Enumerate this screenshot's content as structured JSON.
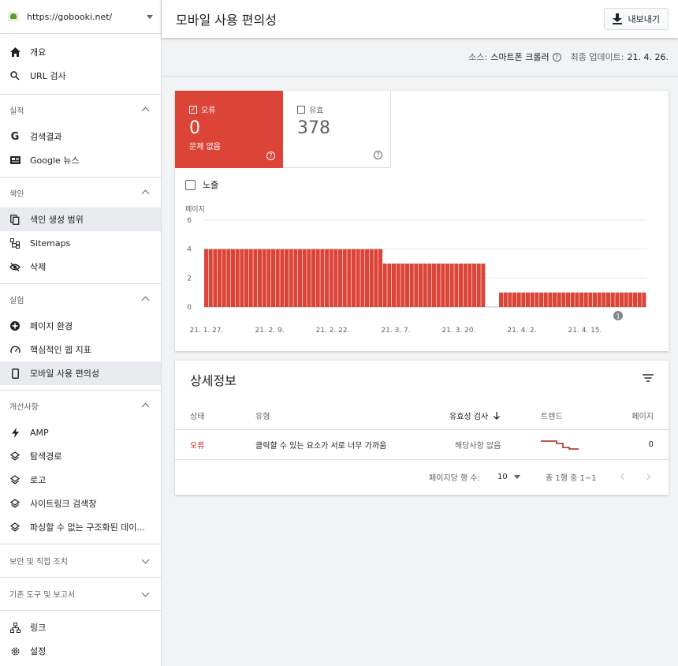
{
  "property": {
    "url": "https://gobooki.net/"
  },
  "sidebar": {
    "top_items": [
      {
        "label": "개요",
        "icon": "home-icon"
      },
      {
        "label": "URL 검사",
        "icon": "search-icon"
      }
    ],
    "sections": [
      {
        "title": "실적",
        "items": [
          {
            "label": "검색결과",
            "icon": "google-icon"
          },
          {
            "label": "Google 뉴스",
            "icon": "news-icon"
          }
        ]
      },
      {
        "title": "색인",
        "items": [
          {
            "label": "색인 생성 범위",
            "icon": "file-copy-icon"
          },
          {
            "label": "Sitemaps",
            "icon": "sitemap-icon"
          },
          {
            "label": "삭제",
            "icon": "eye-off-icon"
          }
        ]
      },
      {
        "title": "실험",
        "items": [
          {
            "label": "페이지 환경",
            "icon": "plus-circle-icon"
          },
          {
            "label": "핵심적인 웹 지표",
            "icon": "speed-icon"
          },
          {
            "label": "모바일 사용 편의성",
            "icon": "phone-icon"
          }
        ]
      },
      {
        "title": "개선사항",
        "items": [
          {
            "label": "AMP",
            "icon": "bolt-icon"
          },
          {
            "label": "탐색경로",
            "icon": "layers-icon"
          },
          {
            "label": "로고",
            "icon": "layers-icon"
          },
          {
            "label": "사이트링크 검색창",
            "icon": "layers-icon"
          },
          {
            "label": "파싱할 수 없는 구조화된 데이...",
            "icon": "layers-icon"
          }
        ]
      }
    ],
    "collapsed_sections": [
      {
        "title": "보안 및 직접 조치"
      },
      {
        "title": "기존 도구 및 보고서"
      }
    ],
    "bottom_items": [
      {
        "label": "링크",
        "icon": "links-icon"
      },
      {
        "label": "설정",
        "icon": "gear-icon"
      }
    ]
  },
  "header": {
    "title": "모바일 사용 편의성",
    "export_label": "내보내기"
  },
  "source_bar": {
    "source_label": "소스:",
    "source_value": "스마트폰 크롤러",
    "updated_label": "최종 업데이트:",
    "updated_value": "21. 4. 26."
  },
  "stats": {
    "error": {
      "label": "오류",
      "count": "0",
      "sub": "문제 없음",
      "color": "#db4437"
    },
    "valid": {
      "label": "유효",
      "count": "378"
    }
  },
  "impressions_label": "노출",
  "chart_data": {
    "type": "bar",
    "ylabel": "페이지",
    "ylim": [
      0,
      6
    ],
    "yticks": [
      0,
      2,
      4,
      6
    ],
    "x_tick_labels": [
      "21. 1. 27.",
      "21. 2. 9.",
      "21. 2. 22.",
      "21. 3. 7.",
      "21. 3. 20.",
      "21. 4. 2.",
      "21. 4. 15."
    ],
    "annotation": "1",
    "color": "#db4437",
    "series": [
      {
        "values": [
          4,
          4,
          4,
          4,
          4,
          4,
          4,
          4,
          4,
          4,
          4,
          4,
          4,
          4,
          4,
          4,
          4,
          4,
          4,
          4,
          4,
          4,
          4,
          4,
          4,
          4,
          4,
          4,
          4,
          4,
          4,
          4,
          4,
          4,
          4,
          4,
          4,
          4,
          4,
          4,
          3,
          3,
          3,
          3,
          3,
          3,
          3,
          3,
          3,
          3,
          3,
          3,
          3,
          3,
          3,
          3,
          3,
          3,
          3,
          3,
          3,
          3,
          3,
          0,
          0,
          0,
          1,
          1,
          1,
          1,
          1,
          1,
          1,
          1,
          1,
          1,
          1,
          1,
          1,
          1,
          1,
          1,
          1,
          1,
          1,
          1,
          1,
          1,
          1,
          1,
          1,
          1,
          1,
          1,
          1,
          1,
          1,
          1,
          1
        ]
      }
    ]
  },
  "details": {
    "title": "상세정보",
    "columns": {
      "status": "상태",
      "type": "유형",
      "validation": "유효성 검사",
      "trend": "트렌드",
      "pages": "페이지"
    },
    "rows": [
      {
        "status": "오류",
        "type": "클릭할 수 있는 요소가 서로 너무 가까움",
        "validation": "해당사항 없음",
        "pages": "0"
      }
    ],
    "pager": {
      "rows_per_page_label": "페이지당 행 수:",
      "rows_per_page": "10",
      "range": "총 1행 중 1~1"
    }
  }
}
